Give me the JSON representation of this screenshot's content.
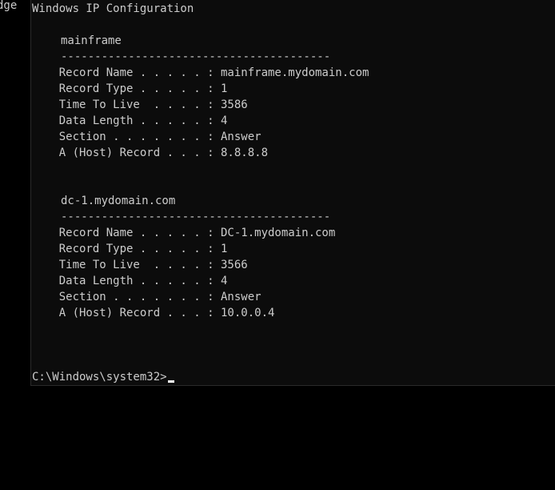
{
  "window": {
    "edge_label": "dge"
  },
  "console": {
    "title_line": "Windows IP Configuration",
    "records": [
      {
        "host": "mainframe",
        "separator": "----------------------------------------",
        "record_name": "    Record Name . . . . . : mainframe.mydomain.com",
        "record_type": "    Record Type . . . . . : 1",
        "ttl": "    Time To Live  . . . . : 3586",
        "data_length": "    Data Length . . . . . : 4",
        "section": "    Section . . . . . . . : Answer",
        "a_record": "    A (Host) Record . . . : 8.8.8.8"
      },
      {
        "host": "dc-1.mydomain.com",
        "separator": "----------------------------------------",
        "record_name": "    Record Name . . . . . : DC-1.mydomain.com",
        "record_type": "    Record Type . . . . . : 1",
        "ttl": "    Time To Live  . . . . : 3566",
        "data_length": "    Data Length . . . . . : 4",
        "section": "    Section . . . . . . . : Answer",
        "a_record": "    A (Host) Record . . . : 10.0.0.4"
      }
    ],
    "prompt": "C:\\Windows\\system32>"
  },
  "colors": {
    "background": "#0c0c0c",
    "text": "#cccccc",
    "cursor": "#ffffff"
  }
}
